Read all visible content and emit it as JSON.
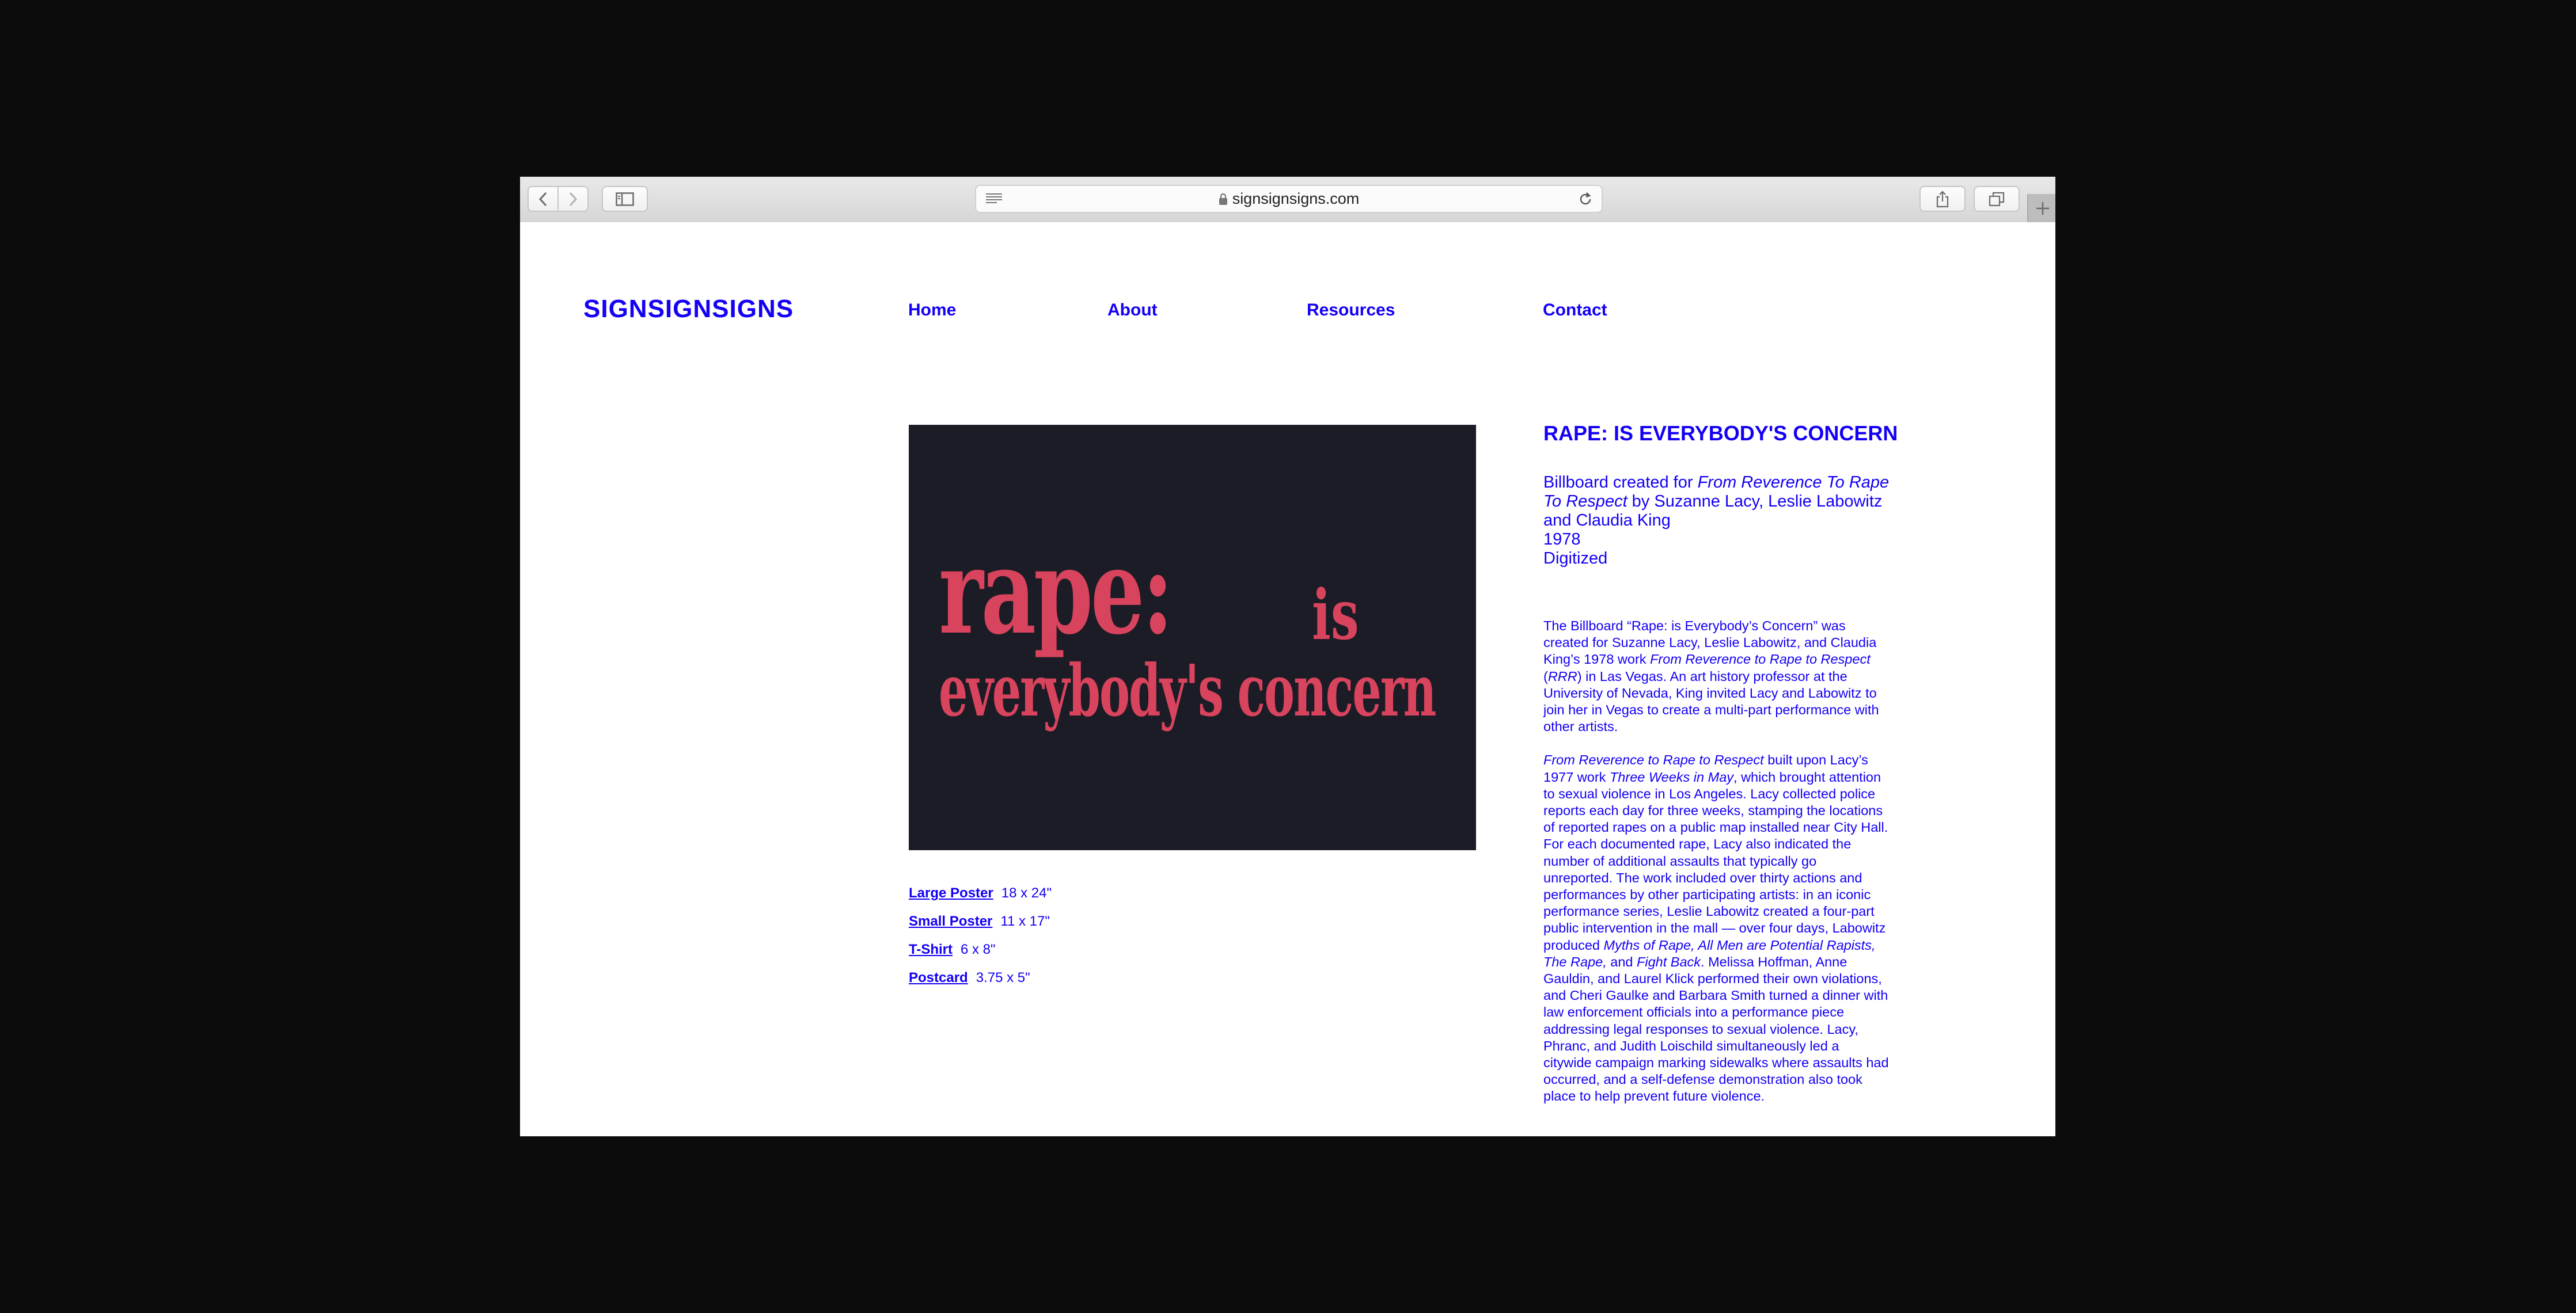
{
  "browser": {
    "url": "signsignsigns.com",
    "icons": [
      "back-chevron-icon",
      "forward-chevron-icon",
      "sidebar-icon",
      "reader-icon",
      "lock-icon",
      "reload-icon",
      "share-icon",
      "tabs-icon",
      "plus-icon"
    ]
  },
  "site": {
    "logo": "SIGNSIGNSIGNS",
    "nav": [
      "Home",
      "About",
      "Resources",
      "Contact"
    ]
  },
  "artwork": {
    "line1": "rape:",
    "line1b": "is",
    "line2": "everybody's concern",
    "background": "#1b1c25",
    "text_color": "#d8435d"
  },
  "products": [
    {
      "name": "Large Poster",
      "size": "18 x 24\""
    },
    {
      "name": "Small Poster",
      "size": "11 x 17\""
    },
    {
      "name": "T-Shirt",
      "size": "6 x 8\""
    },
    {
      "name": "Postcard",
      "size": "3.75 x 5\""
    }
  ],
  "info": {
    "title": "RAPE: IS EVERYBODY'S CONCERN",
    "meta_prefix": "Billboard created for ",
    "meta_work": "From Reverence To Rape To Respect",
    "meta_suffix": " by Suzanne Lacy, Leslie Labowitz and Claudia King",
    "year": "1978",
    "status": "Digitized",
    "p1_a": "The Billboard “Rape: is Everybody’s Concern” was created for Suzanne Lacy, Leslie Labowitz, and Claudia King’s 1978 work ",
    "p1_work": "From Reverence to Rape to Respect",
    "p1_b": " (",
    "p1_abbr": "RRR",
    "p1_c": ") in Las Vegas. An art history professor at the University of Nevada, King invited Lacy and Labowitz to join her in Vegas to create a multi-part performance with other artists.",
    "p2_work": "From Reverence to Rape to Respect",
    "p2_a": " built upon Lacy’s 1977 work ",
    "p2_work2": "Three Weeks in May",
    "p2_b": ", which brought attention to sexual violence in Los Angeles. Lacy collected police reports each day for three weeks, stamping the locations of reported rapes on a public map installed near City Hall. For each documented rape, Lacy also indicated the number of additional assaults that typically go unreported. The work included over thirty actions and performances by other participating artists: in an iconic performance series, Leslie Labowitz created a four-part public intervention in the mall — over four days, Labowitz produced ",
    "p2_work3": "Myths of Rape, All Men are Potential Rapists, The Rape,",
    "p2_c": " and ",
    "p2_work4": "Fight Back",
    "p2_d": ". Melissa Hoffman, Anne Gauldin, and Laurel Klick performed their own violations, and Cheri Gaulke and Barbara Smith turned a dinner with law enforcement officials into a performance piece addressing legal responses to sexual violence. Lacy, Phranc, and Judith Loischild simultaneously led a citywide campaign marking sidewalks where assaults had occurred, and a self-defense demonstration also took place to help prevent future violence."
  },
  "colors": {
    "link": "#1400f5",
    "page_bg": "#ffffff",
    "outer_bg": "#0c0c0c"
  }
}
